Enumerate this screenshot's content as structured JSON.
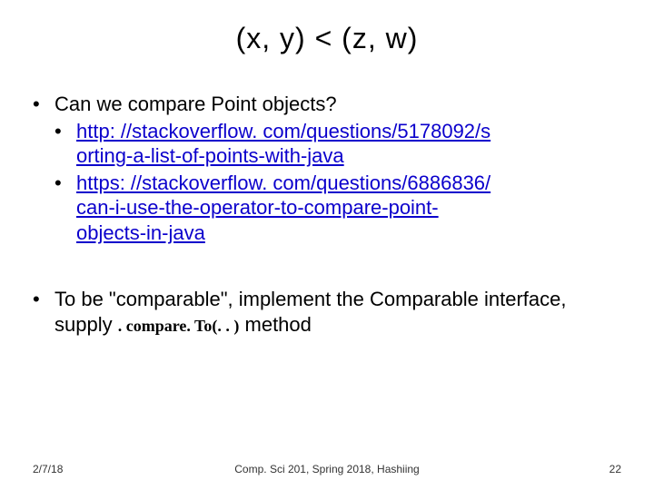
{
  "title": "(x, y) < (z, w)",
  "bullets": {
    "q": "Can we compare Point objects?",
    "link1a": "http: //stackoverflow. com/questions/5178092/s",
    "link1b": "orting-a-list-of-points-with-java",
    "link2a": "https: //stackoverflow. com/questions/6886836/",
    "link2b": "can-i-use-the-operator-to-compare-point-",
    "link2c": "objects-in-java",
    "comp1": "To be \"comparable\", implement the Comparable interface, supply ",
    "method": ". compare. To(. . )",
    "comp2": " method"
  },
  "footer": {
    "date": "2/7/18",
    "course": "Comp. Sci 201, Spring 2018,  Hashiing",
    "page": "22"
  }
}
